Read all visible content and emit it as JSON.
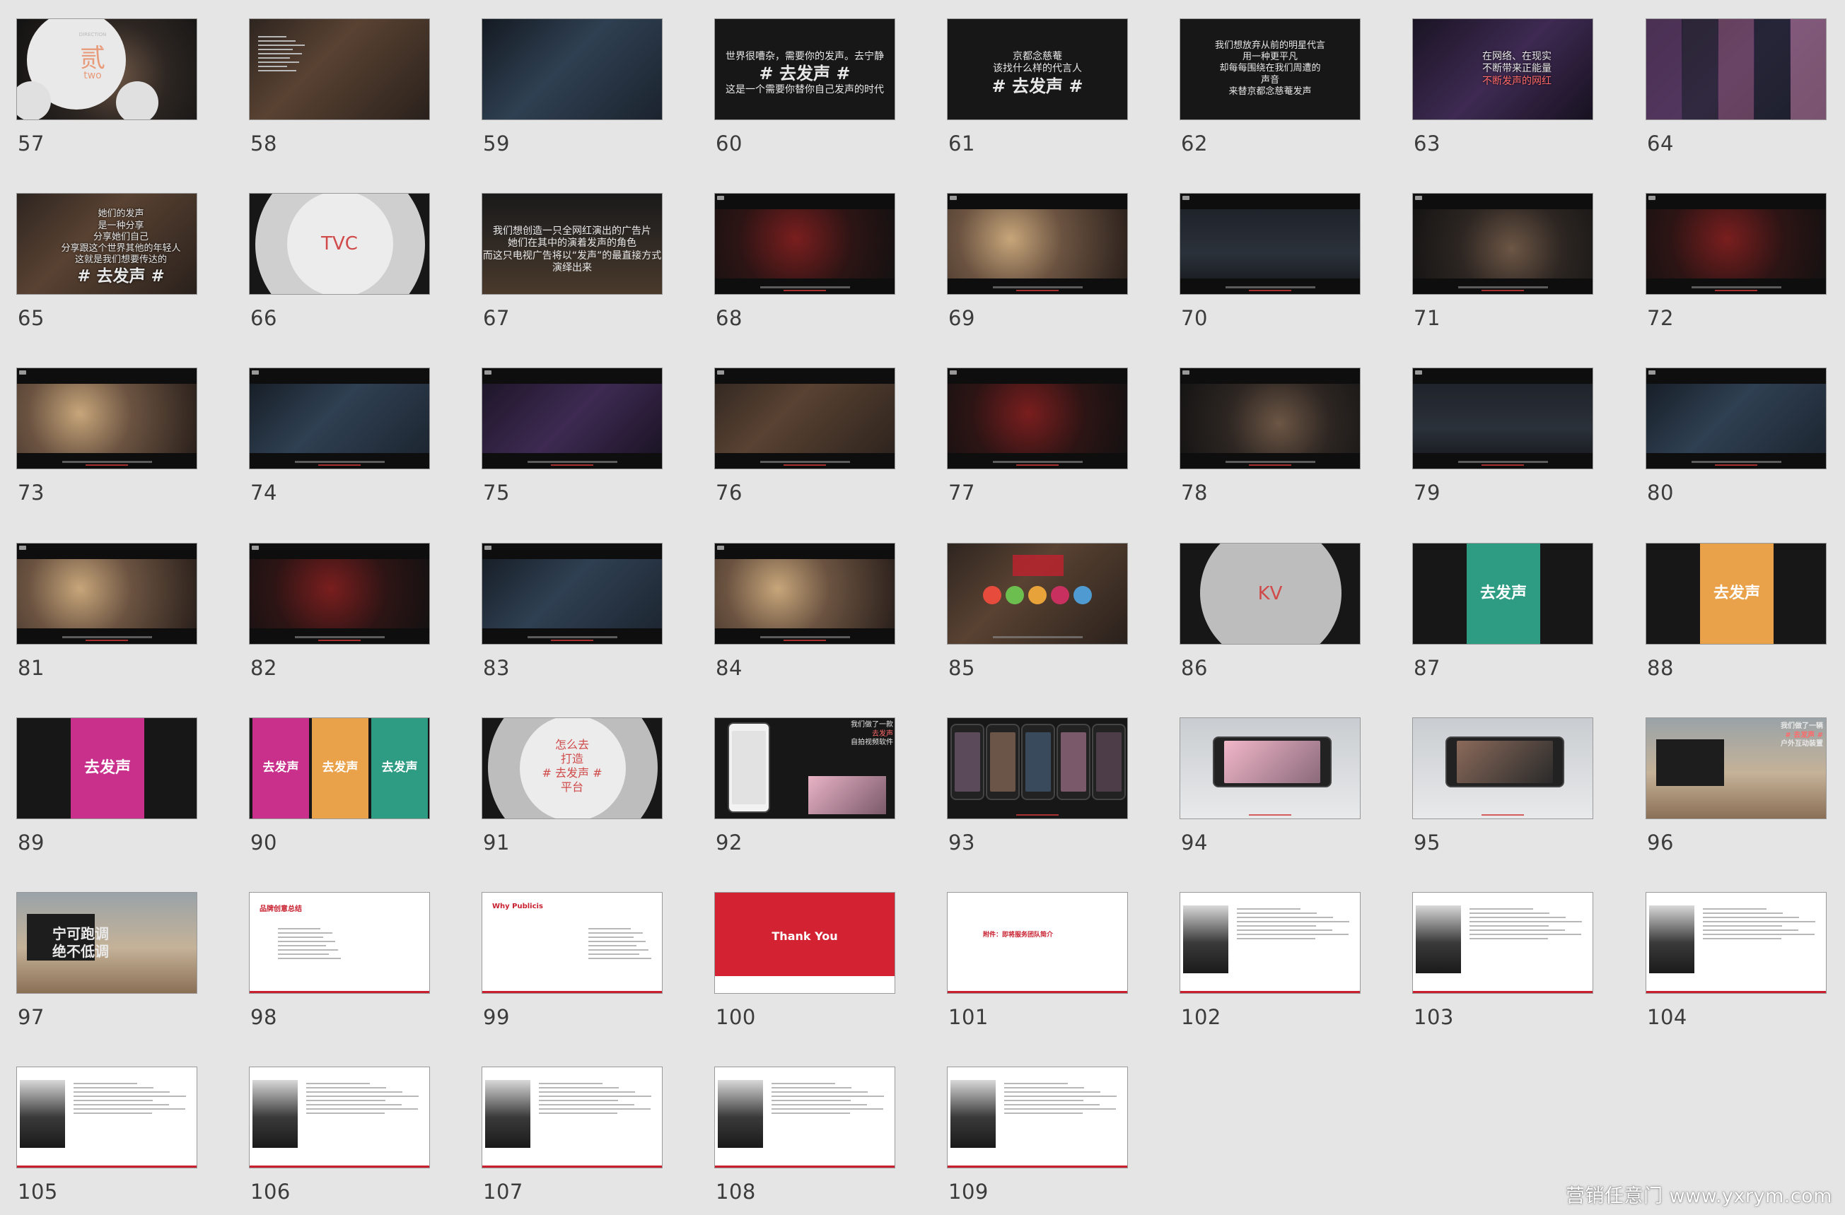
{
  "slides": [
    {
      "number": "57",
      "kind": "section",
      "bg": "bg-photo-face",
      "circle_text": "贰",
      "circle_sub": "two",
      "circle_label": "DIRECTION",
      "accent": "#e89b7a"
    },
    {
      "number": "58",
      "kind": "textlist",
      "bg": "bg-photo-warm"
    },
    {
      "number": "59",
      "kind": "photo",
      "bg": "bg-photo-cool"
    },
    {
      "number": "60",
      "kind": "quote",
      "bg": "bg-dark",
      "lines": [
        "世界很嘈杂，需要你的发声。去宁静",
        "# 去发声 #",
        "这是一个需要你替你自己发声的时代"
      ]
    },
    {
      "number": "61",
      "kind": "quote",
      "bg": "bg-dark",
      "lines": [
        "京都念慈菴",
        "该找什么样的代言人",
        "# 去发声 #"
      ]
    },
    {
      "number": "62",
      "kind": "quote",
      "bg": "bg-dark",
      "lines": [
        "我们想放弃从前的明星代言",
        "用一种更平凡",
        "却每每围绕在我们周遭的",
        "声音",
        "来替京都念慈菴发声"
      ]
    },
    {
      "number": "63",
      "kind": "quote-photo",
      "bg": "bg-photo-purple",
      "lines": [
        "在网络、在现实",
        "不断带来正能量",
        "不断发声的网红"
      ]
    },
    {
      "number": "64",
      "kind": "collage",
      "bg": "bg-photo-purple"
    },
    {
      "number": "65",
      "kind": "quote-photo",
      "bg": "bg-photo-warm",
      "lines": [
        "她们的发声",
        "是一种分享",
        "分享她们自己",
        "分享跟这个世界其他的年轻人",
        "这就是我们想要传达的",
        "# 去发声 #"
      ]
    },
    {
      "number": "66",
      "kind": "section",
      "bg": "bg-dark",
      "circle_text": "TVC",
      "accent": "#d04a4a"
    },
    {
      "number": "67",
      "kind": "quote",
      "bg": "bg-photo-street",
      "lines": [
        "我们想创造一只全网红演出的广告片",
        "她们在其中的演着发声的角色",
        "而这只电视广告将以“发声”的最直接方式演绎出来"
      ]
    },
    {
      "number": "68",
      "kind": "film",
      "bg": "bg-photo-red"
    },
    {
      "number": "69",
      "kind": "film",
      "bg": "bg-photo-gold"
    },
    {
      "number": "70",
      "kind": "film",
      "bg": "bg-night"
    },
    {
      "number": "71",
      "kind": "film",
      "bg": "bg-photo-face"
    },
    {
      "number": "72",
      "kind": "film",
      "bg": "bg-photo-red"
    },
    {
      "number": "73",
      "kind": "film",
      "bg": "bg-photo-gold"
    },
    {
      "number": "74",
      "kind": "film",
      "bg": "bg-photo-cool"
    },
    {
      "number": "75",
      "kind": "film",
      "bg": "bg-photo-purple"
    },
    {
      "number": "76",
      "kind": "film",
      "bg": "bg-photo-warm"
    },
    {
      "number": "77",
      "kind": "film",
      "bg": "bg-photo-red"
    },
    {
      "number": "78",
      "kind": "film",
      "bg": "bg-photo-face"
    },
    {
      "number": "79",
      "kind": "film",
      "bg": "bg-night"
    },
    {
      "number": "80",
      "kind": "film",
      "bg": "bg-photo-cool"
    },
    {
      "number": "81",
      "kind": "film",
      "bg": "bg-photo-gold"
    },
    {
      "number": "82",
      "kind": "film",
      "bg": "bg-photo-red"
    },
    {
      "number": "83",
      "kind": "film",
      "bg": "bg-photo-cool"
    },
    {
      "number": "84",
      "kind": "film",
      "bg": "bg-photo-gold"
    },
    {
      "number": "85",
      "kind": "product",
      "bg": "bg-photo-warm"
    },
    {
      "number": "86",
      "kind": "section",
      "bg": "bg-dark",
      "circle_text": "KV",
      "accent": "#d04a4a"
    },
    {
      "number": "87",
      "kind": "poster",
      "bg": "bg-dark",
      "poster_bg": "bg-green",
      "poster_text": "去发声"
    },
    {
      "number": "88",
      "kind": "poster",
      "bg": "bg-dark",
      "poster_bg": "bg-orange",
      "poster_text": "去发声"
    },
    {
      "number": "89",
      "kind": "poster-wide",
      "bg": "bg-dark",
      "poster_bg": "bg-magenta",
      "poster_text": "去发声"
    },
    {
      "number": "90",
      "kind": "poster-triple",
      "bg": "bg-dark",
      "poster_text": "去发声"
    },
    {
      "number": "91",
      "kind": "section",
      "bg": "bg-dark",
      "circle_lines": [
        "怎么去",
        "打造",
        "# 去发声 #",
        "平台"
      ],
      "accent": "#d04a4a"
    },
    {
      "number": "92",
      "kind": "app",
      "bg": "bg-dark",
      "lines": [
        "我们做了一款",
        "去发声",
        "自拍视频软件"
      ]
    },
    {
      "number": "93",
      "kind": "phones",
      "bg": "bg-dark"
    },
    {
      "number": "94",
      "kind": "phone-land",
      "bg": "bg-mist"
    },
    {
      "number": "95",
      "kind": "phone-land",
      "bg": "bg-mist"
    },
    {
      "number": "96",
      "kind": "stage",
      "bg": "bg-stage",
      "lines": [
        "我们做了一辆",
        "# 去发声 #",
        "户外互动装置"
      ]
    },
    {
      "number": "97",
      "kind": "stage",
      "bg": "bg-stage",
      "lines": [
        "宁可跑调",
        "绝不低调"
      ]
    },
    {
      "number": "98",
      "kind": "summary",
      "bg": "bg-white",
      "title": "品牌创意总结"
    },
    {
      "number": "99",
      "kind": "why",
      "bg": "bg-white",
      "title": "Why Publicis"
    },
    {
      "number": "100",
      "kind": "thanks",
      "bg": "bg-red",
      "title": "Thank You"
    },
    {
      "number": "101",
      "kind": "team-title",
      "bg": "bg-white",
      "title": "附件：即将服务团队简介"
    },
    {
      "number": "102",
      "kind": "profile",
      "bg": "bg-white"
    },
    {
      "number": "103",
      "kind": "profile",
      "bg": "bg-white"
    },
    {
      "number": "104",
      "kind": "profile",
      "bg": "bg-white"
    },
    {
      "number": "105",
      "kind": "profile",
      "bg": "bg-white"
    },
    {
      "number": "106",
      "kind": "profile",
      "bg": "bg-white"
    },
    {
      "number": "107",
      "kind": "profile",
      "bg": "bg-white"
    },
    {
      "number": "108",
      "kind": "profile",
      "bg": "bg-white"
    },
    {
      "number": "109",
      "kind": "profile",
      "bg": "bg-white"
    }
  ],
  "watermark": "营销任意门 www.yxrym.com"
}
